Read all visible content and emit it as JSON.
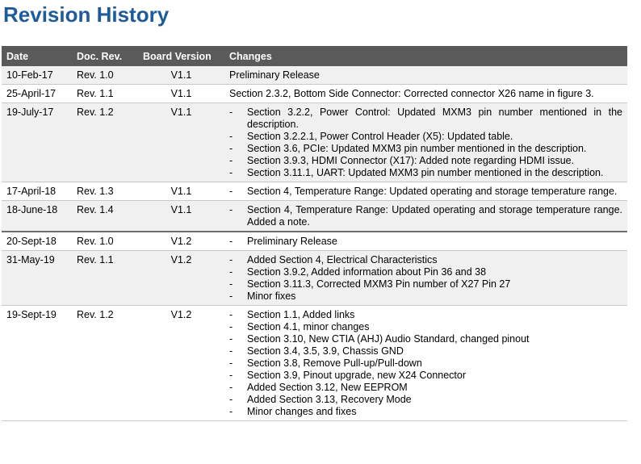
{
  "title": "Revision History",
  "headers": {
    "date": "Date",
    "doc_rev": "Doc. Rev.",
    "board_version": "Board Version",
    "changes": "Changes"
  },
  "rows": [
    {
      "date": "10-Feb-17",
      "doc_rev": "Rev. 1.0",
      "board_version": "V1.1",
      "plain": "Preliminary Release"
    },
    {
      "date": "25-April-17",
      "doc_rev": "Rev. 1.1",
      "board_version": "V1.1",
      "plain": "Section 2.3.2, Bottom Side Connector: Corrected connector X26 name in figure 3."
    },
    {
      "date": "19-July-17",
      "doc_rev": "Rev. 1.2",
      "board_version": "V1.1",
      "bullets": [
        "Section 3.2.2, Power Control: Updated MXM3 pin number mentioned in the description.",
        "Section 3.2.2.1, Power Control Header (X5): Updated table.",
        "Section 3.6, PCIe: Updated MXM3 pin number mentioned in the description.",
        "Section 3.9.3, HDMI Connector (X17): Added note regarding HDMI issue.",
        "Section 3.11.1, UART: Updated MXM3 pin number mentioned in the description."
      ]
    },
    {
      "date": "17-April-18",
      "doc_rev": "Rev. 1.3",
      "board_version": "V1.1",
      "bullets": [
        "Section 4, Temperature Range: Updated operating and storage temperature range."
      ]
    },
    {
      "date": "18-June-18",
      "doc_rev": "Rev. 1.4",
      "board_version": "V1.1",
      "bullets": [
        "Section 4, Temperature Range: Updated operating and storage temperature range. Added a note."
      ]
    },
    {
      "date": "20-Sept-18",
      "doc_rev": "Rev. 1.0",
      "board_version": "V1.2",
      "bullets": [
        "Preliminary Release"
      ]
    },
    {
      "date": "31-May-19",
      "doc_rev": "Rev. 1.1",
      "board_version": "V1.2",
      "bullets": [
        "Added Section 4, Electrical Characteristics",
        "Section 3.9.2, Added information about Pin 36 and 38",
        "Section 3.11.3, Corrected MXM3 Pin number of X27 Pin 27",
        "Minor fixes"
      ]
    },
    {
      "date": "19-Sept-19",
      "doc_rev": "Rev. 1.2",
      "board_version": "V1.2",
      "bullets": [
        "Section 1.1, Added links",
        "Section 4.1, minor changes",
        "Section 3.10, New CTIA (AHJ) Audio Standard, changed pinout",
        "Section 3.4, 3.5, 3.9, Chassis GND",
        "Section 3.8, Remove Pull-up/Pull-down",
        "Section 3.9, Pinout upgrade, new X24 Connector",
        "Added Section 3.12, New EEPROM",
        "Added Section 3.13, Recovery Mode",
        "Minor changes and fixes"
      ]
    }
  ]
}
